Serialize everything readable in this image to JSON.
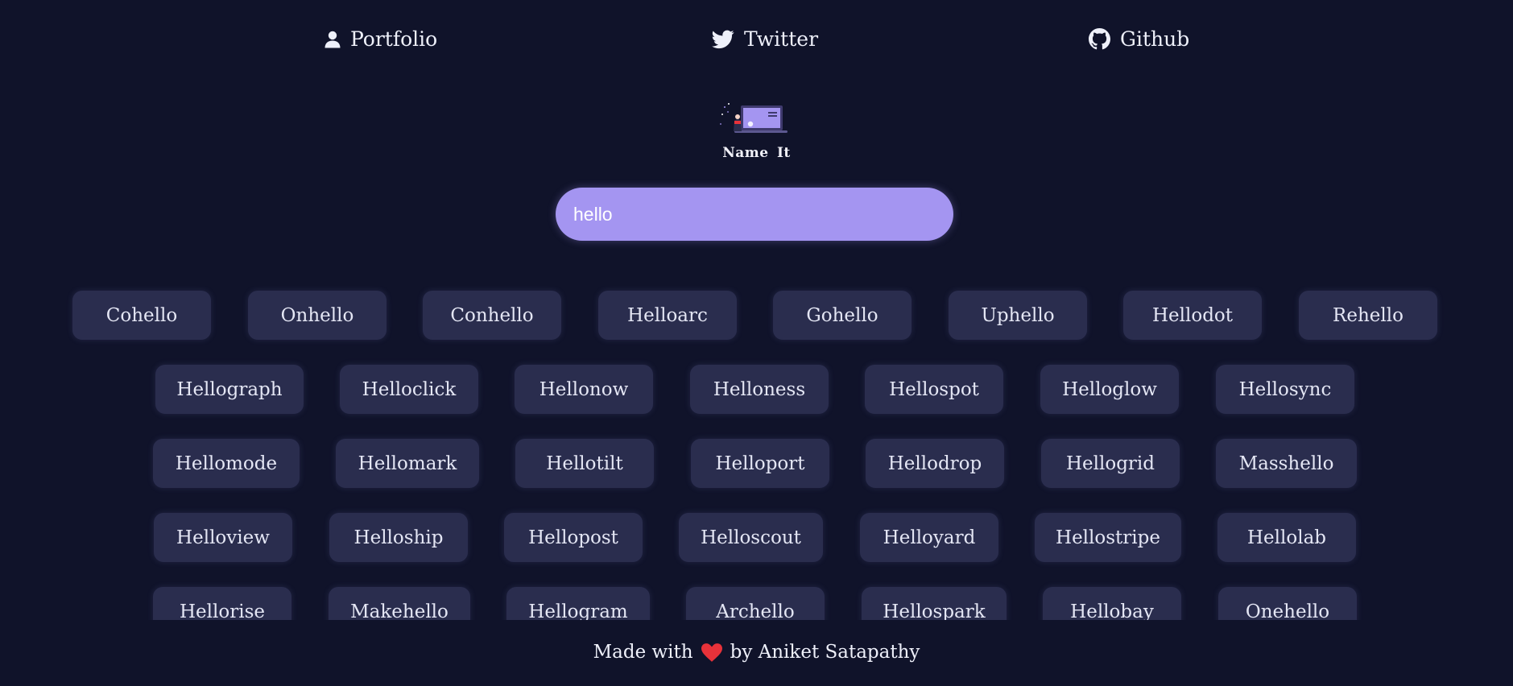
{
  "nav": {
    "portfolio": {
      "label": "Portfolio",
      "icon": "user-icon"
    },
    "twitter": {
      "label": "Twitter",
      "icon": "twitter-icon"
    },
    "github": {
      "label": "Github",
      "icon": "github-icon"
    }
  },
  "brand": {
    "name": "Name It"
  },
  "search": {
    "value": "hello"
  },
  "results": [
    [
      "Cohello",
      "Onhello",
      "Conhello",
      "Helloarc",
      "Gohello",
      "Uphello",
      "Hellodot",
      "Rehello"
    ],
    [
      "Hellograph",
      "Helloclick",
      "Hellonow",
      "Helloness",
      "Hellospot",
      "Helloglow",
      "Hellosync"
    ],
    [
      "Hellomode",
      "Hellomark",
      "Hellotilt",
      "Helloport",
      "Hellodrop",
      "Hellogrid",
      "Masshello"
    ],
    [
      "Helloview",
      "Helloship",
      "Hellopost",
      "Helloscout",
      "Helloyard",
      "Hellostripe",
      "Hellolab"
    ],
    [
      "Hellorise",
      "Makehello",
      "Hellogram",
      "Archello",
      "Hellospark",
      "Hellobay",
      "Onehello"
    ]
  ],
  "footer": {
    "prefix": "Made with",
    "icon": "heart-icon",
    "suffix": "by Aniket Satapathy"
  },
  "colors": {
    "background": "#10132a",
    "chip": "#2a2d4e",
    "search": "#a495f1",
    "heart": "#e8323a"
  }
}
